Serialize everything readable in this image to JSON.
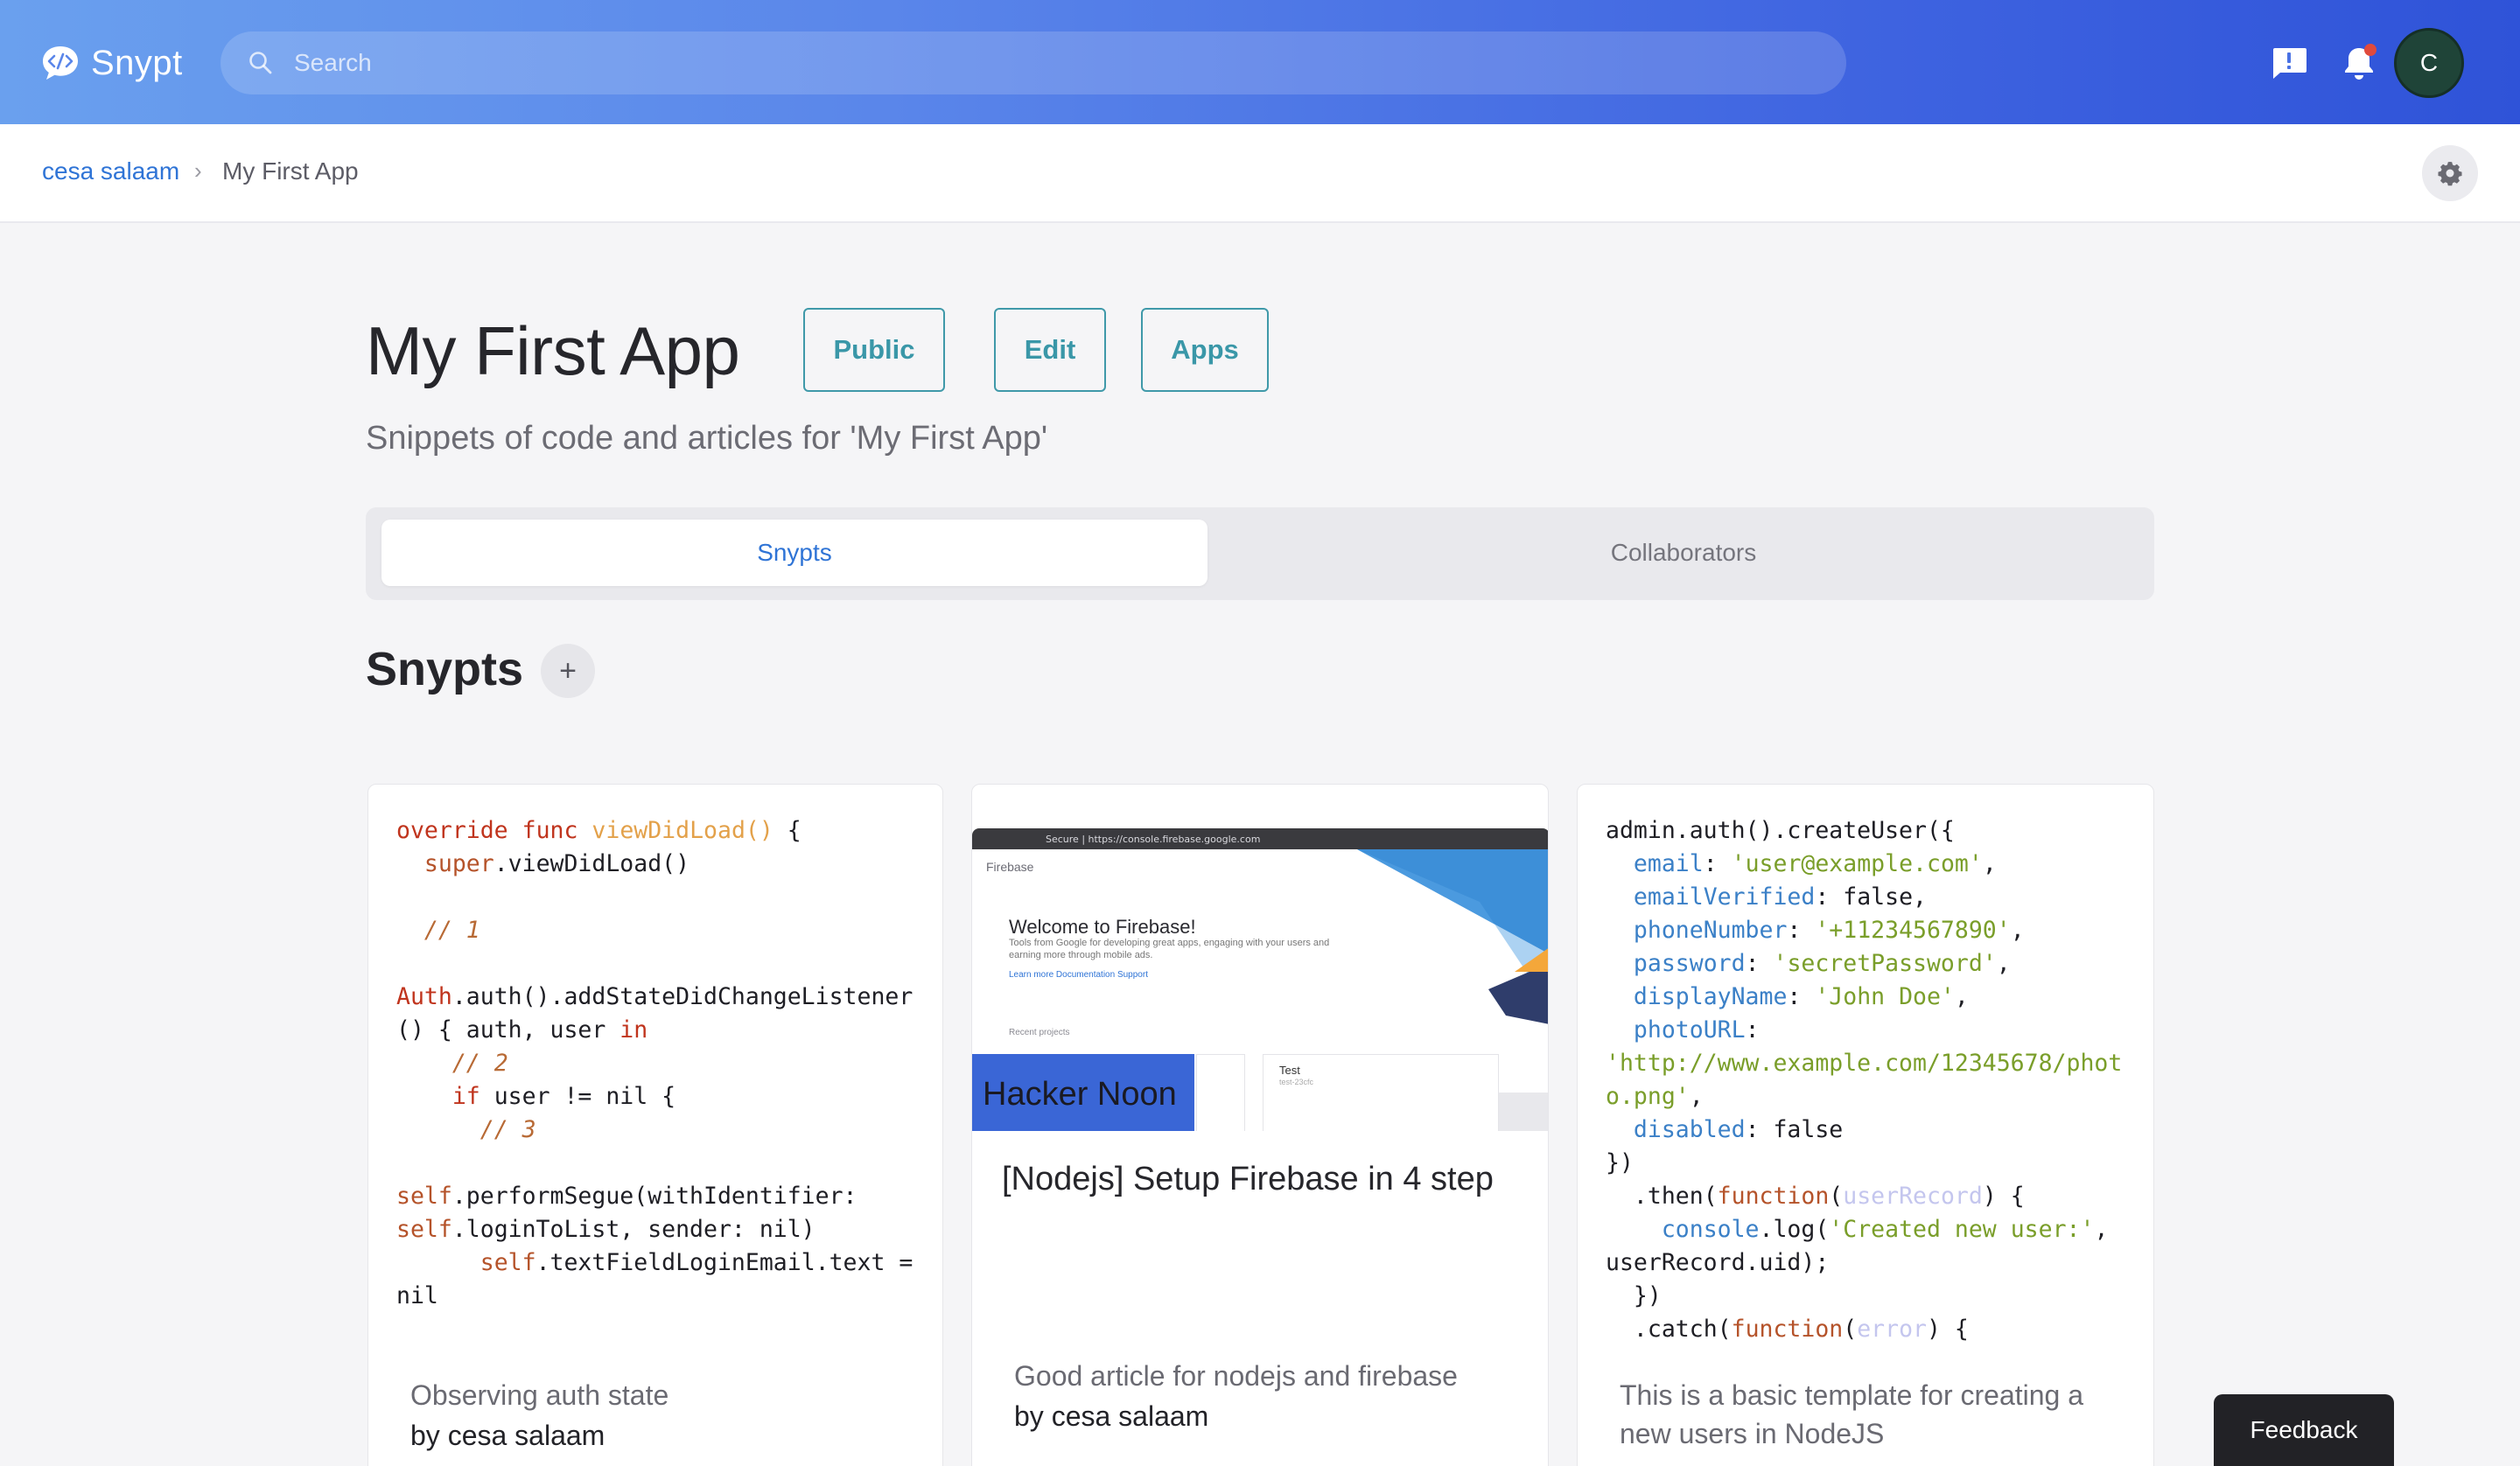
{
  "app": {
    "brand_name": "Snypt"
  },
  "navbar": {
    "search_placeholder": "Search",
    "avatar_initial": "C",
    "icons": [
      "brand-logo-icon",
      "search-icon",
      "feedback-icon",
      "bell-icon"
    ],
    "colors": {
      "gradient_start": "#6aa0ee",
      "gradient_end": "#2f53d8",
      "notification_dot": "#e04a3c",
      "avatar_bg": "#1f4438"
    }
  },
  "breadcrumb": {
    "parent": "cesa salaam",
    "separator": "›",
    "current": "My First App"
  },
  "header": {
    "title": "My First App",
    "subtitle": "Snippets of code and articles for 'My First App'",
    "buttons": {
      "public": "Public",
      "edit": "Edit",
      "apps": "Apps"
    },
    "accent_color": "#3a97a8"
  },
  "tabs": [
    {
      "label": "Snypts",
      "active": true
    },
    {
      "label": "Collaborators",
      "active": false
    }
  ],
  "section": {
    "title": "Snypts",
    "add_label": "+"
  },
  "cards": [
    {
      "type": "code",
      "code_lines": [
        "override func viewDidLoad() {",
        "  super.viewDidLoad()",
        "",
        "  // 1",
        "",
        "Auth.auth().addStateDidChangeListener",
        "() { auth, user in",
        "    // 2",
        "    if user != nil {",
        "      // 3",
        "",
        "self.performSegue(withIdentifier:",
        "self.loginToList, sender: nil)",
        "      self.textFieldLoginEmail.text =",
        "nil"
      ],
      "description": "Observing auth state",
      "author": "by cesa salaam"
    },
    {
      "type": "article",
      "thumbnail": {
        "url_text": "Secure | https://console.firebase.google.com",
        "site_label": "Firebase",
        "welcome": "Welcome to Firebase!",
        "tools_text": "Tools from Google for developing great apps, engaging with your users and earning more through mobile ads.",
        "links": "Learn more    Documentation    Support",
        "recent": "Recent projects",
        "overlay": "Hacker Noon",
        "project_name": "Test",
        "project_id": "test-23cfc"
      },
      "title": "[Nodejs] Setup Firebase in 4 step",
      "description": "Good article for nodejs and firebase",
      "author": "by cesa salaam"
    },
    {
      "type": "code",
      "code_lines": [
        "admin.auth().createUser({",
        "  email: 'user@example.com',",
        "  emailVerified: false,",
        "  phoneNumber: '+11234567890',",
        "  password: 'secretPassword',",
        "  displayName: 'John Doe',",
        "  photoURL:",
        "'http://www.example.com/12345678/photo.png',",
        "  disabled: false",
        "})",
        "  .then(function(userRecord) {",
        "    console.log('Created new user:',",
        "userRecord.uid);",
        "  })",
        "  .catch(function(error) {"
      ],
      "description": "This is a basic template for creating a new users in NodeJS",
      "author": ""
    }
  ],
  "feedback": {
    "label": "Feedback"
  }
}
